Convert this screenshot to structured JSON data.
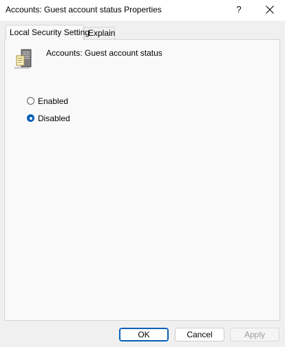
{
  "window": {
    "title": "Accounts: Guest account status Properties",
    "help_label": "?"
  },
  "tabs": [
    {
      "label": "Local Security Setting",
      "active": true
    },
    {
      "label": "Explain",
      "active": false
    }
  ],
  "policy": {
    "icon": "server-computer-icon",
    "name": "Accounts: Guest account status"
  },
  "options": [
    {
      "label": "Enabled",
      "selected": false
    },
    {
      "label": "Disabled",
      "selected": true
    }
  ],
  "buttons": {
    "ok": "OK",
    "cancel": "Cancel",
    "apply": "Apply"
  },
  "colors": {
    "accent": "#005fb8",
    "disabled_text": "#9b9b9b"
  }
}
